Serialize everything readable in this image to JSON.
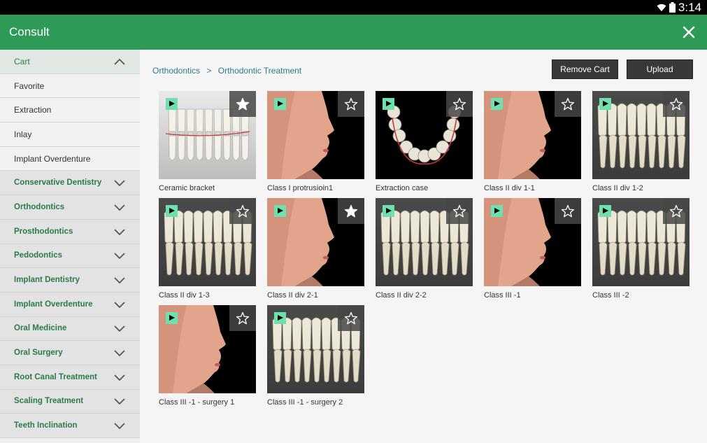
{
  "status": {
    "time": "3:14"
  },
  "app": {
    "title": "Consult"
  },
  "sidebar": {
    "items": [
      {
        "label": "Cart",
        "kind": "header"
      },
      {
        "label": "Favorite",
        "kind": "sub"
      },
      {
        "label": "Extraction",
        "kind": "sub"
      },
      {
        "label": "Inlay",
        "kind": "sub"
      },
      {
        "label": "Implant Overdenture",
        "kind": "sub"
      },
      {
        "label": "Conservative Dentistry",
        "kind": "cat"
      },
      {
        "label": "Orthodontics",
        "kind": "cat"
      },
      {
        "label": "Prosthodontics",
        "kind": "cat"
      },
      {
        "label": "Pedodontics",
        "kind": "cat"
      },
      {
        "label": "Implant Dentistry",
        "kind": "cat"
      },
      {
        "label": "Implant Overdenture",
        "kind": "cat"
      },
      {
        "label": "Oral Medicine",
        "kind": "cat"
      },
      {
        "label": "Oral Surgery",
        "kind": "cat"
      },
      {
        "label": "Root Canal Treatment",
        "kind": "cat"
      },
      {
        "label": "Scaling Treatment",
        "kind": "cat"
      },
      {
        "label": "Teeth Inclination",
        "kind": "cat"
      }
    ]
  },
  "breadcrumb": {
    "root": "Orthodontics",
    "separator": ">",
    "current": "Orthodontic Treatment"
  },
  "toolbar": {
    "remove_label": "Remove Cart",
    "upload_label": "Upload"
  },
  "items": [
    {
      "label": "Ceramic bracket",
      "art": "bracket",
      "favorite": true
    },
    {
      "label": "Class I protrusioin1",
      "art": "face",
      "favorite": false
    },
    {
      "label": "Extraction case",
      "art": "arch",
      "favorite": false
    },
    {
      "label": "Class II div 1-1",
      "art": "face",
      "favorite": false
    },
    {
      "label": "Class II div 1-2",
      "art": "teeth",
      "favorite": false
    },
    {
      "label": "Class II div 1-3",
      "art": "teeth",
      "favorite": false
    },
    {
      "label": "Class II div 2-1",
      "art": "face",
      "favorite": true
    },
    {
      "label": "Class II div 2-2",
      "art": "teeth",
      "favorite": false
    },
    {
      "label": "Class III -1",
      "art": "face",
      "favorite": false
    },
    {
      "label": "Class III -2",
      "art": "teeth",
      "favorite": false
    },
    {
      "label": "Class III -1 - surgery 1",
      "art": "face",
      "favorite": false
    },
    {
      "label": "Class III -1 - surgery 2",
      "art": "teeth",
      "favorite": false
    }
  ],
  "colors": {
    "accent": "#2e9a57",
    "category_text": "#2b7b4a",
    "play_badge": "#6ee0b0"
  }
}
